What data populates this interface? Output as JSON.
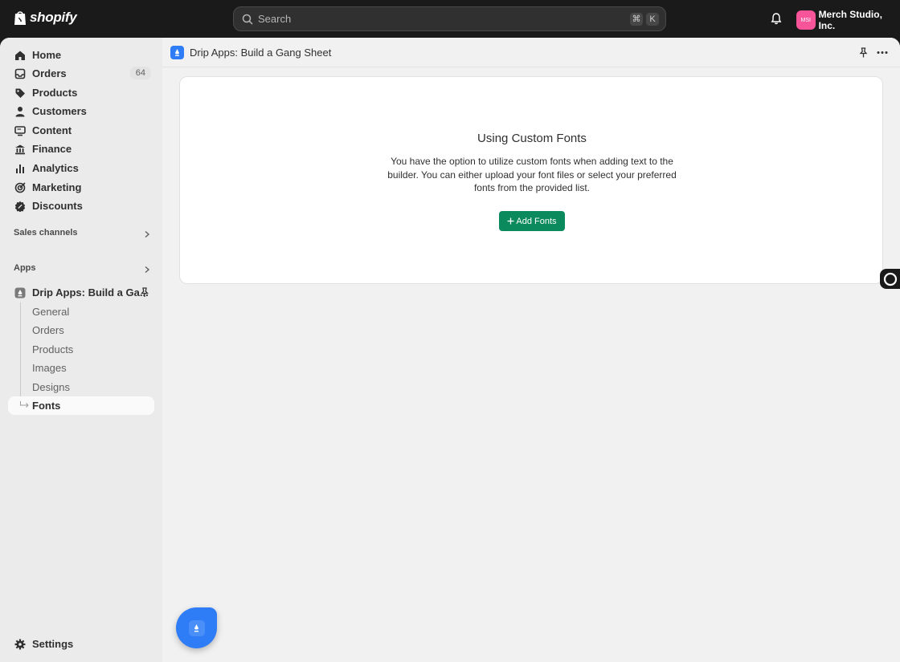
{
  "topbar": {
    "brand": "shopify",
    "search_placeholder": "Search",
    "shortcut_keys": [
      "⌘",
      "K"
    ],
    "store_initials": "MSI",
    "store_name": "Merch Studio, Inc."
  },
  "sidebar": {
    "nav": [
      {
        "label": "Home",
        "icon": "home-icon"
      },
      {
        "label": "Orders",
        "icon": "inbox-icon",
        "badge": "64"
      },
      {
        "label": "Products",
        "icon": "tag-icon"
      },
      {
        "label": "Customers",
        "icon": "person-icon"
      },
      {
        "label": "Content",
        "icon": "monitor-icon"
      },
      {
        "label": "Finance",
        "icon": "bank-icon"
      },
      {
        "label": "Analytics",
        "icon": "bar-chart-icon"
      },
      {
        "label": "Marketing",
        "icon": "target-icon"
      },
      {
        "label": "Discounts",
        "icon": "discount-icon"
      }
    ],
    "sales_channels_label": "Sales channels",
    "apps_label": "Apps",
    "app_name": "Drip Apps: Build a Ga...",
    "app_subitems": [
      "General",
      "Orders",
      "Products",
      "Images",
      "Designs",
      "Fonts"
    ],
    "active_subitem": "Fonts",
    "settings_label": "Settings"
  },
  "main": {
    "app_title": "Drip Apps: Build a Gang Sheet",
    "card": {
      "title": "Using Custom Fonts",
      "body": "You have the option to utilize custom fonts when adding text to the builder. You can either upload your font files or select your preferred fonts from the provided list.",
      "button_label": "Add Fonts"
    }
  },
  "colors": {
    "topbar_bg": "#1a1a1a",
    "accent_green": "#0b8a5d",
    "app_blue": "#2e7cf6",
    "store_avatar": "#f7549a"
  }
}
